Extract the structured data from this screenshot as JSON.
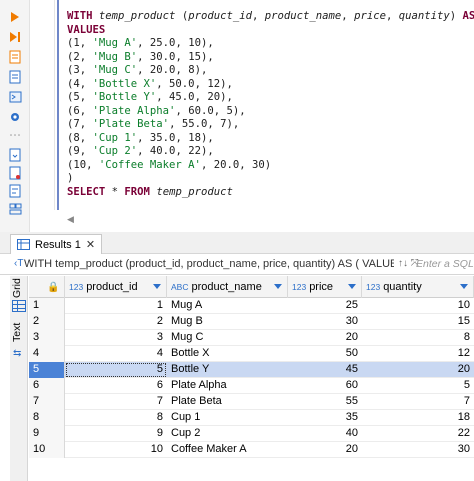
{
  "editor": {
    "lines": [
      [
        {
          "t": "WITH ",
          "c": "kw"
        },
        {
          "t": "temp_product",
          "c": "id"
        },
        {
          "t": " (",
          "c": ""
        },
        {
          "t": "product_id",
          "c": "id"
        },
        {
          "t": ", ",
          "c": ""
        },
        {
          "t": "product_name",
          "c": "id"
        },
        {
          "t": ", ",
          "c": ""
        },
        {
          "t": "price",
          "c": "id"
        },
        {
          "t": ", ",
          "c": ""
        },
        {
          "t": "quantity",
          "c": "id"
        },
        {
          "t": ") ",
          "c": ""
        },
        {
          "t": "AS",
          "c": "kw"
        },
        {
          "t": " (",
          "c": ""
        }
      ],
      [
        {
          "t": "VALUES",
          "c": "kw"
        }
      ],
      [
        {
          "t": "(1, ",
          "c": ""
        },
        {
          "t": "'Mug A'",
          "c": "str"
        },
        {
          "t": ", 25.0, 10),",
          "c": ""
        }
      ],
      [
        {
          "t": "(2, ",
          "c": ""
        },
        {
          "t": "'Mug B'",
          "c": "str"
        },
        {
          "t": ", 30.0, 15),",
          "c": ""
        }
      ],
      [
        {
          "t": "(3, ",
          "c": ""
        },
        {
          "t": "'Mug C'",
          "c": "str"
        },
        {
          "t": ", 20.0, 8),",
          "c": ""
        }
      ],
      [
        {
          "t": "(4, ",
          "c": ""
        },
        {
          "t": "'Bottle X'",
          "c": "str"
        },
        {
          "t": ", 50.0, 12),",
          "c": ""
        }
      ],
      [
        {
          "t": "(5, ",
          "c": ""
        },
        {
          "t": "'Bottle Y'",
          "c": "str"
        },
        {
          "t": ", 45.0, 20),",
          "c": ""
        }
      ],
      [
        {
          "t": "(6, ",
          "c": ""
        },
        {
          "t": "'Plate Alpha'",
          "c": "str"
        },
        {
          "t": ", 60.0, 5),",
          "c": ""
        }
      ],
      [
        {
          "t": "(7, ",
          "c": ""
        },
        {
          "t": "'Plate Beta'",
          "c": "str"
        },
        {
          "t": ", 55.0, 7),",
          "c": ""
        }
      ],
      [
        {
          "t": "(8, ",
          "c": ""
        },
        {
          "t": "'Cup 1'",
          "c": "str"
        },
        {
          "t": ", 35.0, 18),",
          "c": ""
        }
      ],
      [
        {
          "t": "(9, ",
          "c": ""
        },
        {
          "t": "'Cup 2'",
          "c": "str"
        },
        {
          "t": ", 40.0, 22),",
          "c": ""
        }
      ],
      [
        {
          "t": "(10, ",
          "c": ""
        },
        {
          "t": "'Coffee Maker A'",
          "c": "str"
        },
        {
          "t": ", 20.0, 30)",
          "c": ""
        }
      ],
      [
        {
          "t": ")",
          "c": ""
        }
      ],
      [
        {
          "t": "SELECT",
          "c": "kw"
        },
        {
          "t": " * ",
          "c": ""
        },
        {
          "t": "FROM",
          "c": "kw"
        },
        {
          "t": " ",
          "c": ""
        },
        {
          "t": "temp_product",
          "c": "id"
        }
      ]
    ]
  },
  "results": {
    "tab_label": "Results 1",
    "tab_close": "✕",
    "filter_icon": "‹T",
    "filter_text": "WITH temp_product (product_id, product_name, price, quantity) AS ( VALUES (1, '",
    "filter_buttons": "↑↓ ⤧",
    "filter_placeholder": "Enter a SQL",
    "side_tabs": {
      "grid": "Grid",
      "text": "Text"
    },
    "columns": [
      {
        "type_badge": "123",
        "name": "product_id"
      },
      {
        "type_badge": "ABC",
        "name": "product_name"
      },
      {
        "type_badge": "123",
        "name": "price"
      },
      {
        "type_badge": "123",
        "name": "quantity"
      }
    ],
    "rows": [
      {
        "n": "1",
        "product_id": "1",
        "product_name": "Mug A",
        "price": "25",
        "quantity": "10"
      },
      {
        "n": "2",
        "product_id": "2",
        "product_name": "Mug B",
        "price": "30",
        "quantity": "15"
      },
      {
        "n": "3",
        "product_id": "3",
        "product_name": "Mug C",
        "price": "20",
        "quantity": "8"
      },
      {
        "n": "4",
        "product_id": "4",
        "product_name": "Bottle X",
        "price": "50",
        "quantity": "12"
      },
      {
        "n": "5",
        "product_id": "5",
        "product_name": "Bottle Y",
        "price": "45",
        "quantity": "20"
      },
      {
        "n": "6",
        "product_id": "6",
        "product_name": "Plate Alpha",
        "price": "60",
        "quantity": "5"
      },
      {
        "n": "7",
        "product_id": "7",
        "product_name": "Plate Beta",
        "price": "55",
        "quantity": "7"
      },
      {
        "n": "8",
        "product_id": "8",
        "product_name": "Cup 1",
        "price": "35",
        "quantity": "18"
      },
      {
        "n": "9",
        "product_id": "9",
        "product_name": "Cup 2",
        "price": "40",
        "quantity": "22"
      },
      {
        "n": "10",
        "product_id": "10",
        "product_name": "Coffee Maker A",
        "price": "20",
        "quantity": "30"
      }
    ],
    "selected_row": 5
  },
  "icons": [
    "play-icon",
    "play-step-icon",
    "script-icon",
    "explain-plan-icon",
    "console-icon",
    "settings-icon",
    "export-icon",
    "import-icon",
    "format-icon",
    "layout-icon"
  ],
  "colors": {
    "accent": "#2c6fc9",
    "keyword": "#7a0036",
    "string": "#0a7d2a",
    "selected_row": "#c9d8f2"
  }
}
